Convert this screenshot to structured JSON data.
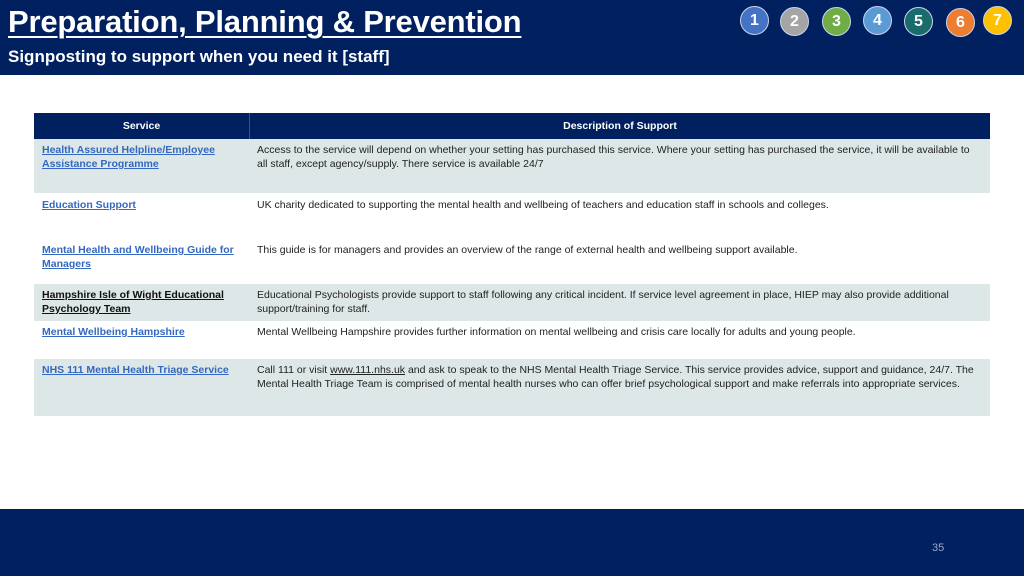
{
  "header": {
    "title": "Preparation, Planning & Prevention",
    "subtitle": "Signposting to support when you need it [staff]"
  },
  "nav": [
    {
      "label": "1",
      "color": "#4472c4"
    },
    {
      "label": "2",
      "color": "#a5a5a5"
    },
    {
      "label": "3",
      "color": "#70ad47"
    },
    {
      "label": "4",
      "color": "#5b9bd5"
    },
    {
      "label": "5",
      "color": "#1a6b6b"
    },
    {
      "label": "6",
      "color": "#ed7d31"
    },
    {
      "label": "7",
      "color": "#ffc000"
    }
  ],
  "table": {
    "headers": [
      "Service",
      "Description of Support"
    ],
    "rows": [
      {
        "service": "Health Assured Helpline/Employee Assistance Programme",
        "description": "Access to the service will depend on whether your setting has purchased this service. Where your setting has purchased the service, it will be available to all staff, except agency/supply. There service is available 24/7"
      },
      {
        "service": "Education Support",
        "description": "UK charity dedicated to supporting the mental health and wellbeing of teachers and education staff in schools and colleges."
      },
      {
        "service": "Mental Health and Wellbeing Guide for Managers",
        "description": "This guide is for managers and provides an overview of the range of external health and wellbeing support available."
      },
      {
        "service": "Hampshire Isle of Wight Educational Psychology Team",
        "description": "Educational Psychologists provide support to staff following any critical incident. If service level agreement in place, HIEP may also provide additional support/training for staff."
      },
      {
        "service": "Mental Wellbeing Hampshire",
        "description": "Mental Wellbeing Hampshire provides further information on mental wellbeing and crisis care locally for adults and young people."
      },
      {
        "service": "NHS 111 Mental Health Triage Service",
        "description_pre": "Call 111 or visit ",
        "description_link": "www.111.nhs.uk",
        "description_post": " and ask to speak to the NHS Mental Health Triage Service. This service provides advice, support and guidance, 24/7. The Mental Health Triage Team is comprised of mental health nurses who can offer brief psychological support and make referrals into appropriate services."
      }
    ]
  },
  "footer": {
    "page_number": "35"
  }
}
